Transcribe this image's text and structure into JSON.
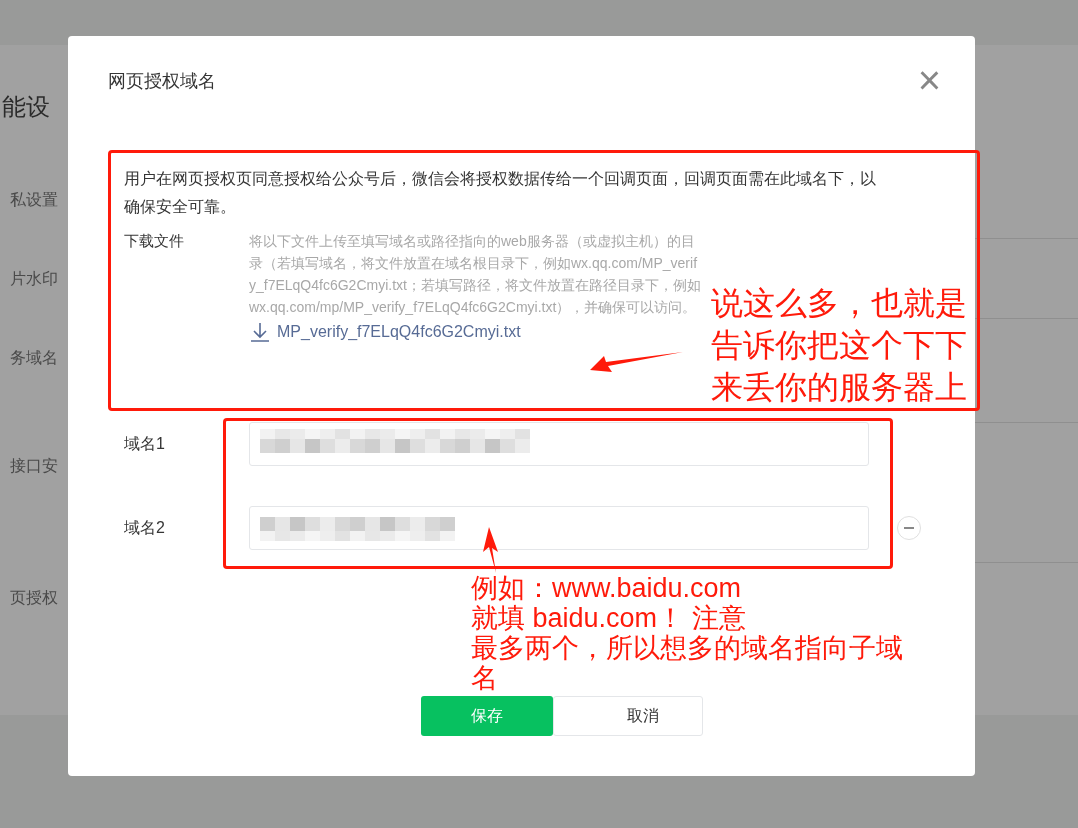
{
  "background_page": {
    "heading": "能设",
    "menu_items": [
      "私设置",
      "片水印",
      "务域名",
      "接口安",
      "页授权"
    ]
  },
  "dialog": {
    "title": "网页授权域名",
    "close_icon": "×",
    "description": "用户在网页授权页同意授权给公众号后，微信会将授权数据传给一个回调页面，回调页面需在此域名下，以确保安全可靠。",
    "download": {
      "label": "下载文件",
      "instructions": "将以下文件上传至填写域名或路径指向的web服务器（或虚拟主机）的目录（若填写域名，将文件放置在域名根目录下，例如wx.qq.com/MP_verify_f7ELqQ4fc6G2Cmyi.txt；若填写路径，将文件放置在路径目录下，例如wx.qq.com/mp/MP_verify_f7ELqQ4fc6G2Cmyi.txt），并确保可以访问。",
      "file_link": "MP_verify_f7ELqQ4fc6G2Cmyi.txt"
    },
    "domains": [
      {
        "label": "域名1",
        "value_redacted": true,
        "removable": false
      },
      {
        "label": "域名2",
        "value_redacted": true,
        "removable": true
      }
    ],
    "buttons": [
      {
        "label": "保存",
        "kind": "primary"
      },
      {
        "label": "取消",
        "kind": "secondary"
      }
    ]
  },
  "annotations": [
    {
      "kind": "right",
      "lines": [
        "说这么多，也就是",
        "告诉你把这个下下",
        "来丢你的服务器上"
      ]
    },
    {
      "kind": "bottom",
      "lines": [
        "例如：www.baidu.com",
        "就填 baidu.com！ 注意",
        "最多两个，所以想多的域名指向子域",
        "名"
      ]
    }
  ]
}
